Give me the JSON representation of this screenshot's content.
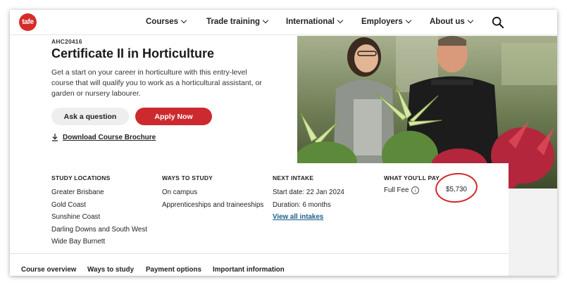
{
  "nav": {
    "logo": "tafe",
    "items": [
      {
        "label": "Courses"
      },
      {
        "label": "Trade training"
      },
      {
        "label": "International"
      },
      {
        "label": "Employers"
      },
      {
        "label": "About us"
      }
    ],
    "search_icon": "search-icon"
  },
  "hero": {
    "code": "AHC20416",
    "title": "Certificate II in Horticulture",
    "description": "Get a start on your career in horticulture with this entry-level course that will qualify you to work as a horticultural assistant, or garden or nursery labourer.",
    "ask_label": "Ask a question",
    "apply_label": "Apply Now",
    "download_label": "Download Course Brochure",
    "accent": "#cc2a2f"
  },
  "info": {
    "study_locations": {
      "heading": "STUDY LOCATIONS",
      "items": [
        "Greater Brisbane",
        "Gold Coast",
        "Sunshine Coast",
        "Darling Downs and South West",
        "Wide Bay Burnett"
      ]
    },
    "ways_to_study": {
      "heading": "WAYS TO STUDY",
      "items": [
        "On campus",
        "Apprenticeships and traineeships"
      ]
    },
    "next_intake": {
      "heading": "NEXT INTAKE",
      "start": "Start date: 22 Jan 2024",
      "duration": "Duration: 6 months",
      "link": "View all intakes"
    },
    "pay": {
      "heading": "WHAT YOU'LL PAY",
      "label": "Full Fee",
      "amount": "$5,730",
      "info_glyph": "i"
    }
  },
  "tabs": [
    {
      "label": "Course overview"
    },
    {
      "label": "Ways to study"
    },
    {
      "label": "Payment options"
    },
    {
      "label": "Important information"
    }
  ]
}
